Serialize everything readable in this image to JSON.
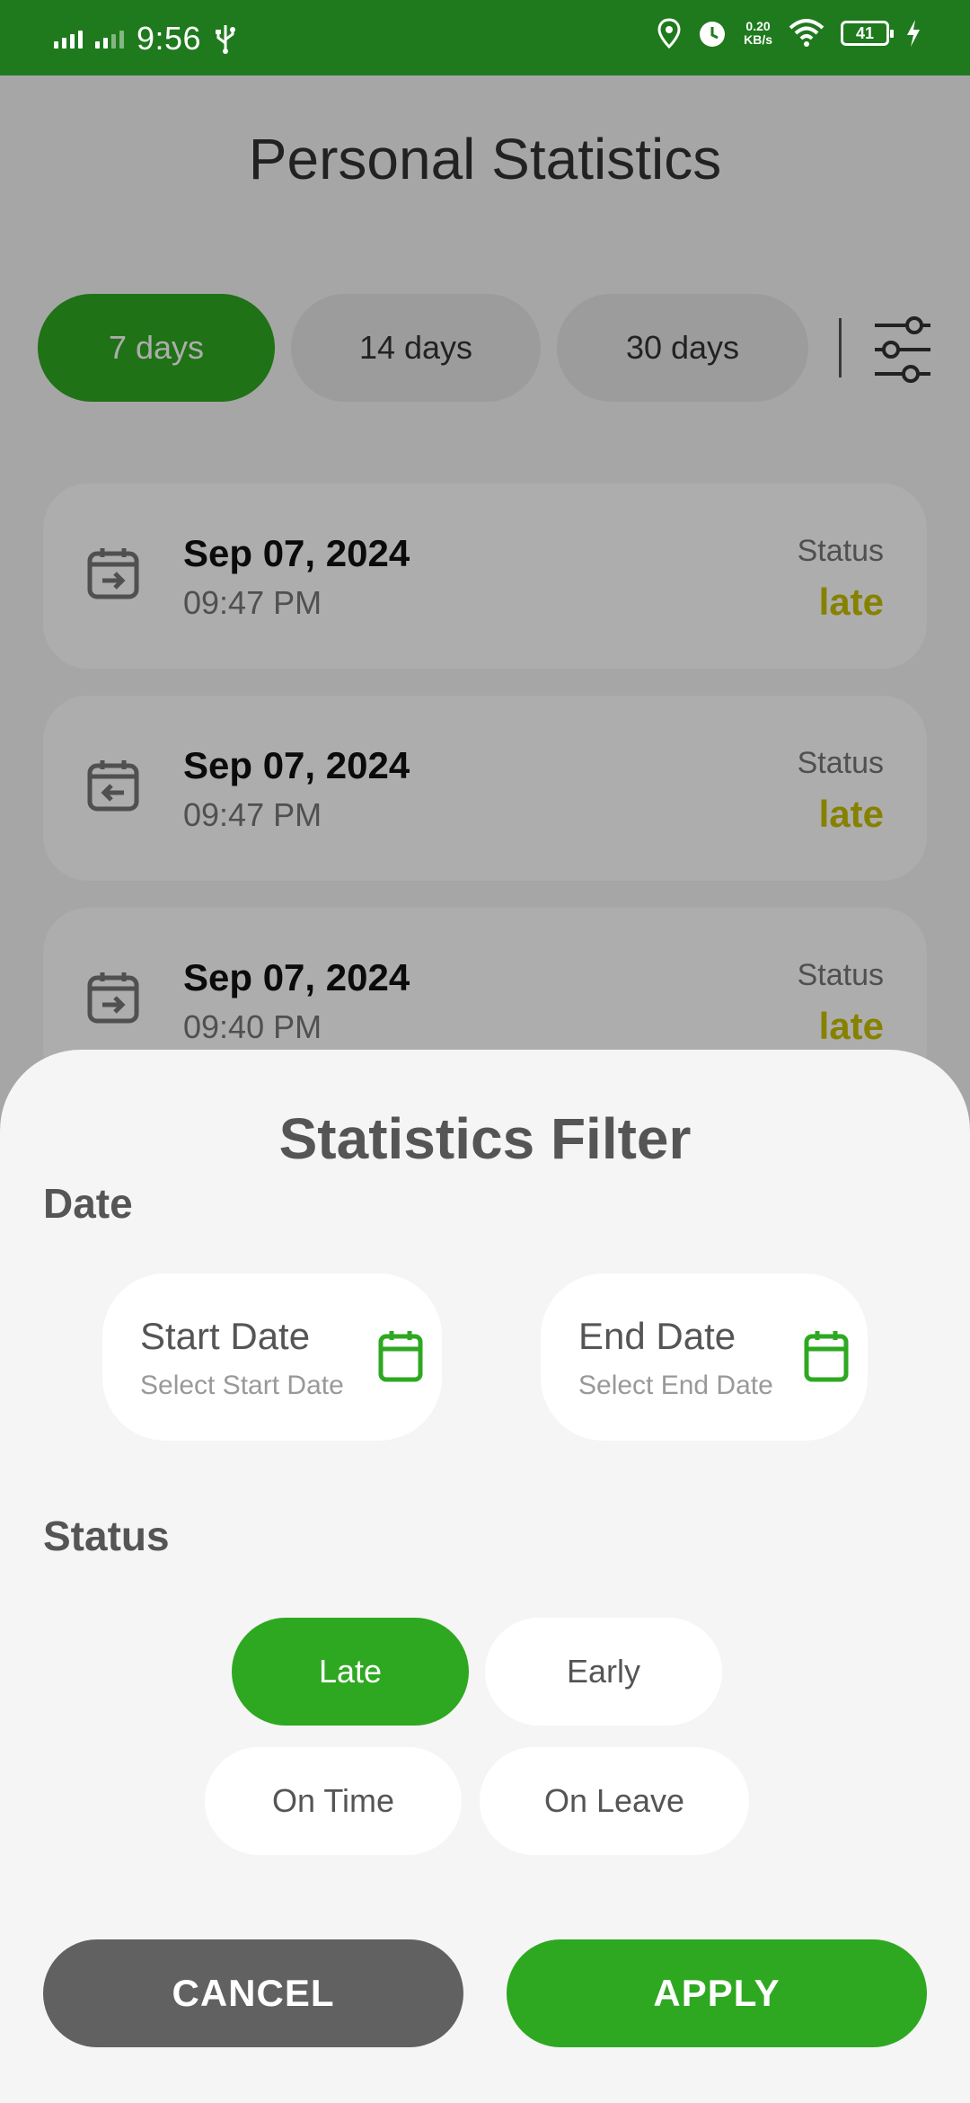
{
  "status_bar": {
    "time": "9:56",
    "network_speed_value": "0.20",
    "network_speed_unit": "KB/s",
    "battery": "41"
  },
  "page": {
    "title": "Personal Statistics",
    "tabs": [
      {
        "label": "7 days",
        "active": true
      },
      {
        "label": "14 days",
        "active": false
      },
      {
        "label": "30 days",
        "active": false
      }
    ],
    "records": [
      {
        "date": "Sep 07, 2024",
        "time": "09:47 PM",
        "status_label": "Status",
        "status": "late",
        "icon": "calendar-arrow-in-icon"
      },
      {
        "date": "Sep 07, 2024",
        "time": "09:47 PM",
        "status_label": "Status",
        "status": "late",
        "icon": "calendar-arrow-out-icon"
      },
      {
        "date": "Sep 07, 2024",
        "time": "09:40 PM",
        "status_label": "Status",
        "status": "late",
        "icon": "calendar-arrow-in-icon"
      }
    ]
  },
  "filter_sheet": {
    "title": "Statistics Filter",
    "date_section": "Date",
    "start_date": {
      "label": "Start Date",
      "placeholder": "Select Start Date"
    },
    "end_date": {
      "label": "End Date",
      "placeholder": "Select End Date"
    },
    "status_section": "Status",
    "status_options": [
      {
        "label": "Late",
        "selected": true
      },
      {
        "label": "Early",
        "selected": false
      },
      {
        "label": "On Time",
        "selected": false
      },
      {
        "label": "On Leave",
        "selected": false
      }
    ],
    "cancel_label": "CANCEL",
    "apply_label": "APPLY"
  },
  "colors": {
    "primary_green": "#2ea821",
    "status_bar_green": "#1f7a1d",
    "late_yellow": "#c7be00",
    "cancel_gray": "#616161"
  }
}
